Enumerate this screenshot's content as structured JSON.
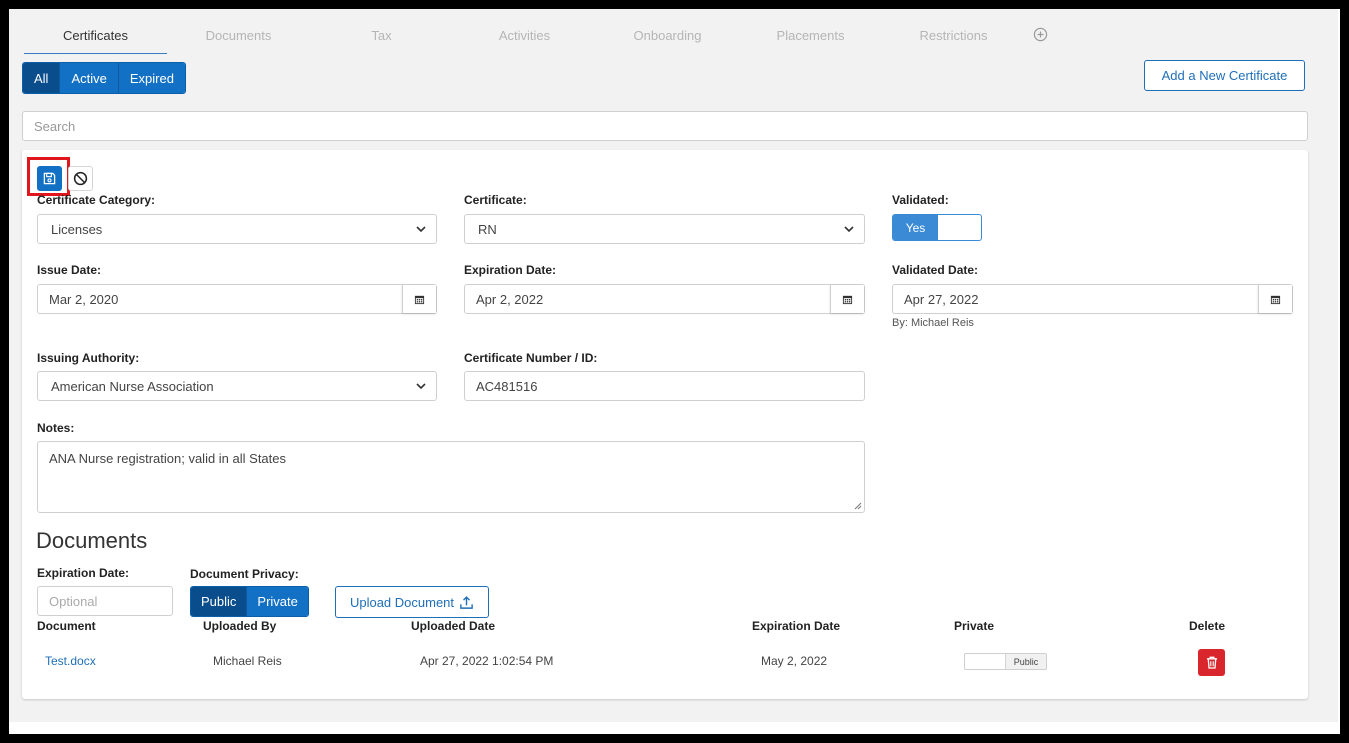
{
  "tabs": [
    {
      "label": "Certificates",
      "active": true
    },
    {
      "label": "Documents",
      "active": false
    },
    {
      "label": "Tax",
      "active": false
    },
    {
      "label": "Activities",
      "active": false
    },
    {
      "label": "Onboarding",
      "active": false
    },
    {
      "label": "Placements",
      "active": false
    },
    {
      "label": "Restrictions",
      "active": false
    }
  ],
  "filters": {
    "all": "All",
    "active": "Active",
    "expired": "Expired",
    "selected": "All"
  },
  "add_certificate_label": "Add a New Certificate",
  "search": {
    "placeholder": "Search",
    "value": ""
  },
  "form": {
    "category_label": "Certificate Category:",
    "category_value": "Licenses",
    "certificate_label": "Certificate:",
    "certificate_value": "RN",
    "validated_label": "Validated:",
    "validated_value": "Yes",
    "issue_date_label": "Issue Date:",
    "issue_date_value": "Mar 2, 2020",
    "expiration_date_label": "Expiration Date:",
    "expiration_date_value": "Apr 2, 2022",
    "validated_date_label": "Validated Date:",
    "validated_date_value": "Apr 27, 2022",
    "validated_by": "By: Michael Reis",
    "issuing_authority_label": "Issuing Authority:",
    "issuing_authority_value": "American Nurse Association",
    "cert_number_label": "Certificate Number / ID:",
    "cert_number_value": "AC481516",
    "notes_label": "Notes:",
    "notes_value": "ANA Nurse registration; valid in all States"
  },
  "documents": {
    "heading": "Documents",
    "expiration_label": "Expiration Date:",
    "expiration_placeholder": "Optional",
    "privacy_label": "Document Privacy:",
    "privacy_public": "Public",
    "privacy_private": "Private",
    "privacy_selected": "Public",
    "upload_label": "Upload Document",
    "columns": {
      "document": "Document",
      "uploaded_by": "Uploaded By",
      "uploaded_date": "Uploaded Date",
      "expiration_date": "Expiration Date",
      "private": "Private",
      "delete": "Delete"
    },
    "rows": [
      {
        "document": "Test.docx",
        "uploaded_by": "Michael Reis",
        "uploaded_date": "Apr 27, 2022 1:02:54 PM",
        "expiration_date": "May 2, 2022",
        "privacy": "Public"
      }
    ]
  },
  "colors": {
    "primary": "#1271c4",
    "primary_dark": "#0a4d8d",
    "danger": "#d9262c",
    "highlight": "#e0161c"
  },
  "icons": [
    "plus-circle-icon",
    "save-icon",
    "ban-icon",
    "chevron-down-icon",
    "calendar-icon",
    "upload-icon",
    "trash-icon"
  ]
}
